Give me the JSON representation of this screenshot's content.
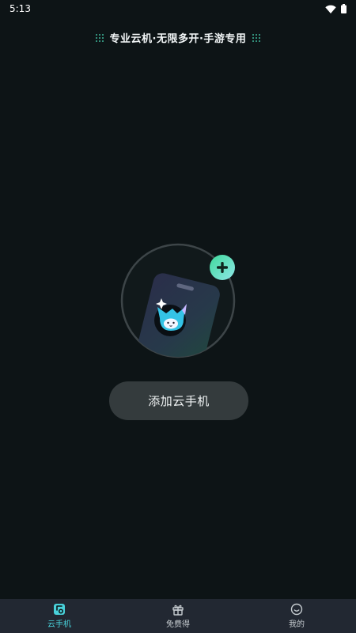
{
  "status_bar": {
    "time": "5:13"
  },
  "header": {
    "slogan": "专业云机·无限多开·手游专用"
  },
  "main": {
    "add_button_label": "添加云手机"
  },
  "bottom_nav": {
    "items": [
      {
        "label": "云手机",
        "icon": "cloud-phone-icon",
        "active": true
      },
      {
        "label": "免费得",
        "icon": "gift-icon",
        "active": false
      },
      {
        "label": "我的",
        "icon": "profile-face-icon",
        "active": false
      }
    ]
  },
  "colors": {
    "background": "#0d1416",
    "accent": "#49d1da",
    "button": "#343b3d",
    "nav_bar": "#222832",
    "plus_badge_from": "#3fd99a",
    "plus_badge_to": "#7ee3e0"
  }
}
